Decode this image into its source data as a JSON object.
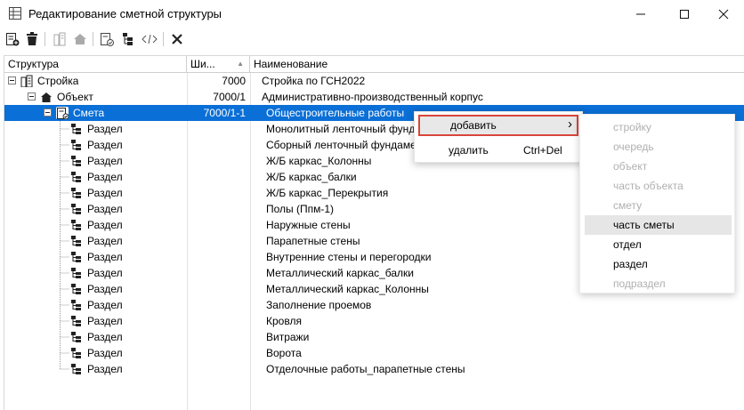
{
  "window": {
    "title": "Редактирование сметной структуры"
  },
  "columns": {
    "structure": "Структура",
    "code": "Ши...",
    "name": "Наименование"
  },
  "rows": [
    {
      "label": "Стройка",
      "code": "7000",
      "name": "Стройка по ГСН2022",
      "icon": "building-icon"
    },
    {
      "label": "Объект",
      "code": "7000/1",
      "name": "Административно-производственный корпус",
      "icon": "house-icon"
    },
    {
      "label": "Смета",
      "code": "7000/1-1",
      "name": "Общестроительные работы",
      "icon": "estimate-doc-icon"
    },
    {
      "label": "Раздел",
      "code": "",
      "name": "Монолитный ленточный фундам",
      "icon": "section-tree-icon"
    },
    {
      "label": "Раздел",
      "code": "",
      "name": "Сборный ленточный фундамент",
      "icon": "section-tree-icon"
    },
    {
      "label": "Раздел",
      "code": "",
      "name": "Ж/Б каркас_Колонны",
      "icon": "section-tree-icon"
    },
    {
      "label": "Раздел",
      "code": "",
      "name": "Ж/Б каркас_балки",
      "icon": "section-tree-icon"
    },
    {
      "label": "Раздел",
      "code": "",
      "name": "Ж/Б каркас_Перекрытия",
      "icon": "section-tree-icon"
    },
    {
      "label": "Раздел",
      "code": "",
      "name": "Полы (Ппм-1)",
      "icon": "section-tree-icon"
    },
    {
      "label": "Раздел",
      "code": "",
      "name": "Наружные стены",
      "icon": "section-tree-icon"
    },
    {
      "label": "Раздел",
      "code": "",
      "name": "Парапетные стены",
      "icon": "section-tree-icon"
    },
    {
      "label": "Раздел",
      "code": "",
      "name": "Внутренние стены и перегородки",
      "icon": "section-tree-icon"
    },
    {
      "label": "Раздел",
      "code": "",
      "name": "Металлический каркас_балки",
      "icon": "section-tree-icon"
    },
    {
      "label": "Раздел",
      "code": "",
      "name": "Металлический каркас_Колонны",
      "icon": "section-tree-icon"
    },
    {
      "label": "Раздел",
      "code": "",
      "name": "Заполнение проемов",
      "icon": "section-tree-icon"
    },
    {
      "label": "Раздел",
      "code": "",
      "name": "Кровля",
      "icon": "section-tree-icon"
    },
    {
      "label": "Раздел",
      "code": "",
      "name": "Витражи",
      "icon": "section-tree-icon"
    },
    {
      "label": "Раздел",
      "code": "",
      "name": "Ворота",
      "icon": "section-tree-icon"
    },
    {
      "label": "Раздел",
      "code": "",
      "name": "Отделочные работы_парапетные стены",
      "icon": "section-tree-icon"
    }
  ],
  "selected_row": 2,
  "context_menu": {
    "add": {
      "label": "добавить",
      "arrow": "›"
    },
    "delete": {
      "label": "удалить",
      "shortcut": "Ctrl+Del"
    }
  },
  "submenu": [
    {
      "label": "стройку",
      "enabled": false
    },
    {
      "label": "очередь",
      "enabled": false
    },
    {
      "label": "объект",
      "enabled": false
    },
    {
      "label": "часть объекта",
      "enabled": false
    },
    {
      "label": "смету",
      "enabled": false
    },
    {
      "label": "часть сметы",
      "enabled": true,
      "hover": true
    },
    {
      "label": "отдел",
      "enabled": true
    },
    {
      "label": "раздел",
      "enabled": true
    },
    {
      "label": "подраздел",
      "enabled": false
    }
  ],
  "colors": {
    "selection": "#0a6fd6",
    "highlight_border": "#d9453a"
  }
}
